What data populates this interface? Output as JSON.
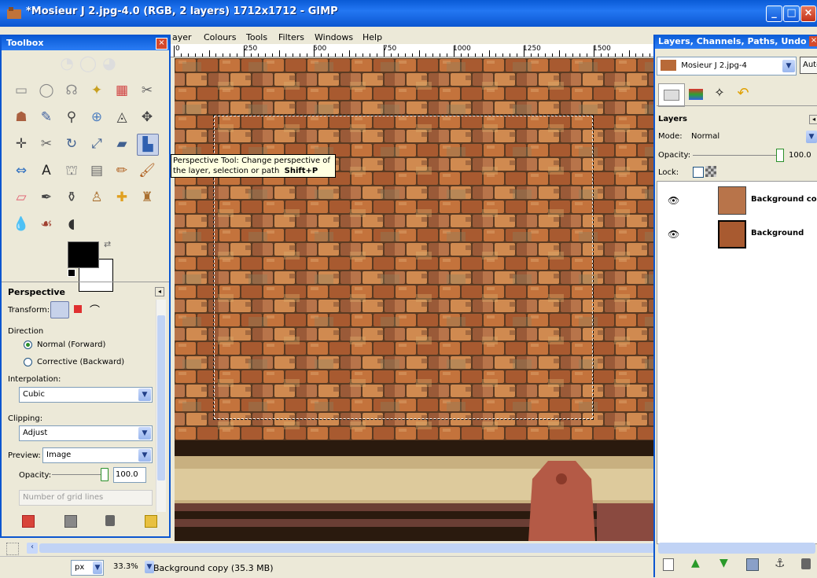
{
  "window": {
    "title": "*Mosieur J 2.jpg-4.0 (RGB, 2 layers) 1712x1712 - GIMP"
  },
  "menu": [
    "ayer",
    "Colours",
    "Tools",
    "Filters",
    "Windows",
    "Help"
  ],
  "ruler": {
    "labels": [
      "0",
      "250",
      "500",
      "750",
      "1000",
      "1250",
      "1500"
    ]
  },
  "tooltip": {
    "line1": "Perspective Tool: Change perspective of",
    "line2": "the layer, selection or path",
    "shortcut": "Shift+P"
  },
  "toolbox": {
    "title": "Toolbox",
    "options_title": "Perspective",
    "transform_label": "Transform:",
    "direction_label": "Direction",
    "direction_options": [
      "Normal (Forward)",
      "Corrective (Backward)"
    ],
    "interpolation_label": "Interpolation:",
    "interpolation_value": "Cubic",
    "clipping_label": "Clipping:",
    "clipping_value": "Adjust",
    "preview_label": "Preview:",
    "preview_value": "Image",
    "opacity_label": "Opacity:",
    "opacity_value": "100.0",
    "grid_placeholder": "Number of grid lines"
  },
  "status": {
    "unit": "px",
    "zoom": "33.3%",
    "info": "Background copy (35.3 MB)"
  },
  "dock": {
    "title": "Layers, Channels, Paths, Undo",
    "image_select": "Mosieur J 2.jpg-4",
    "auto_label": "Auto",
    "layers_heading": "Layers",
    "mode_label": "Mode:",
    "mode_value": "Normal",
    "opacity_label": "Opacity:",
    "opacity_value": "100.0",
    "lock_label": "Lock:",
    "layers": [
      {
        "name": "Background copy"
      },
      {
        "name": "Background"
      }
    ]
  },
  "colors": {
    "titlebar": "#0b56d0",
    "roof": "#b86a38"
  }
}
